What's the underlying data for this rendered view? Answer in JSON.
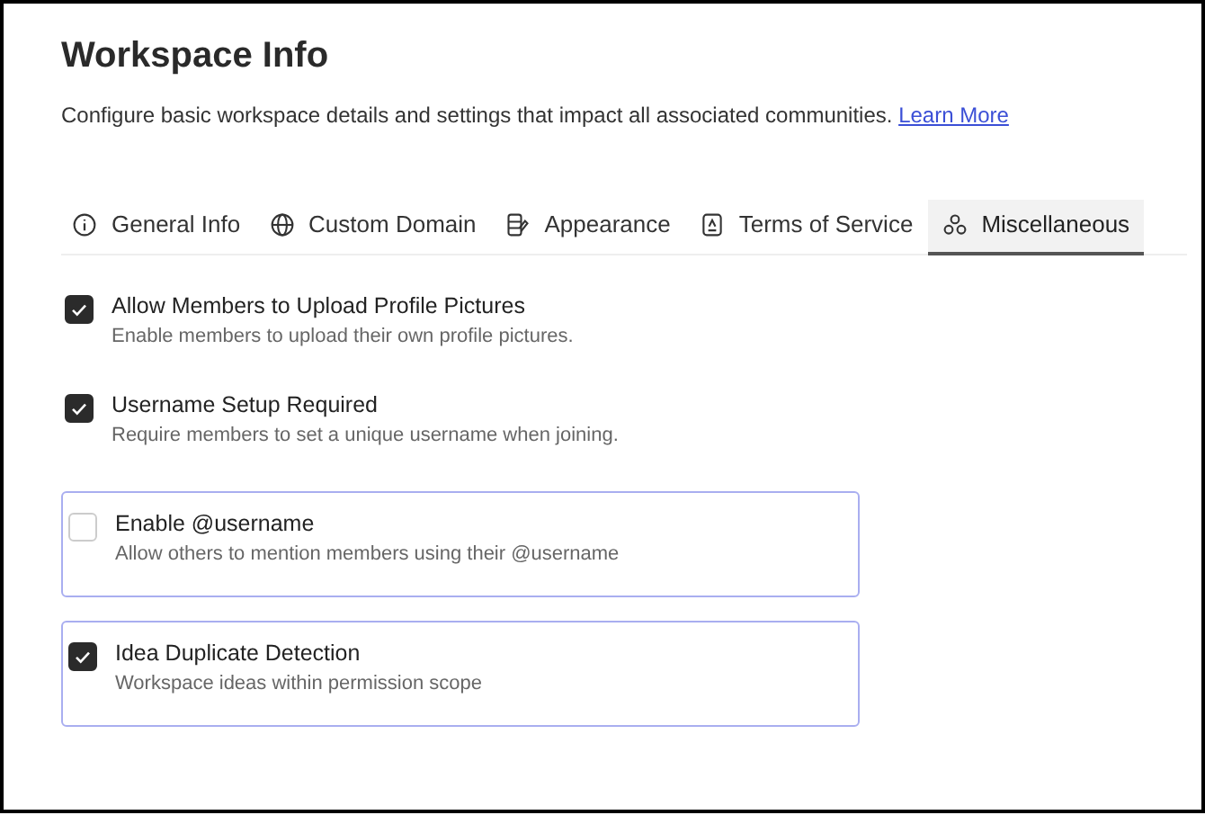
{
  "header": {
    "title": "Workspace Info",
    "description": "Configure basic workspace details and settings that impact all associated communities.",
    "link": "Learn More"
  },
  "tabs": [
    {
      "label": "General Info",
      "selected": false
    },
    {
      "label": "Custom Domain",
      "selected": false
    },
    {
      "label": "Appearance",
      "selected": false
    },
    {
      "label": "Terms of Service",
      "selected": false
    },
    {
      "label": "Miscellaneous",
      "selected": true
    }
  ],
  "settings": [
    {
      "kind": "plain",
      "title": "Allow Members to Upload Profile Pictures",
      "description": "Enable members to upload their own profile pictures.",
      "checked": true
    },
    {
      "kind": "plain",
      "title": "Username Setup Required",
      "description": "Require members to set a unique username when joining.",
      "checked": true
    },
    {
      "kind": "boxed",
      "title": "Enable @username",
      "description": "Allow others to mention members using their @username",
      "checked": false
    },
    {
      "kind": "boxed",
      "title": "Idea Duplicate Detection",
      "description": "Workspace ideas within permission scope",
      "checked": true
    }
  ]
}
